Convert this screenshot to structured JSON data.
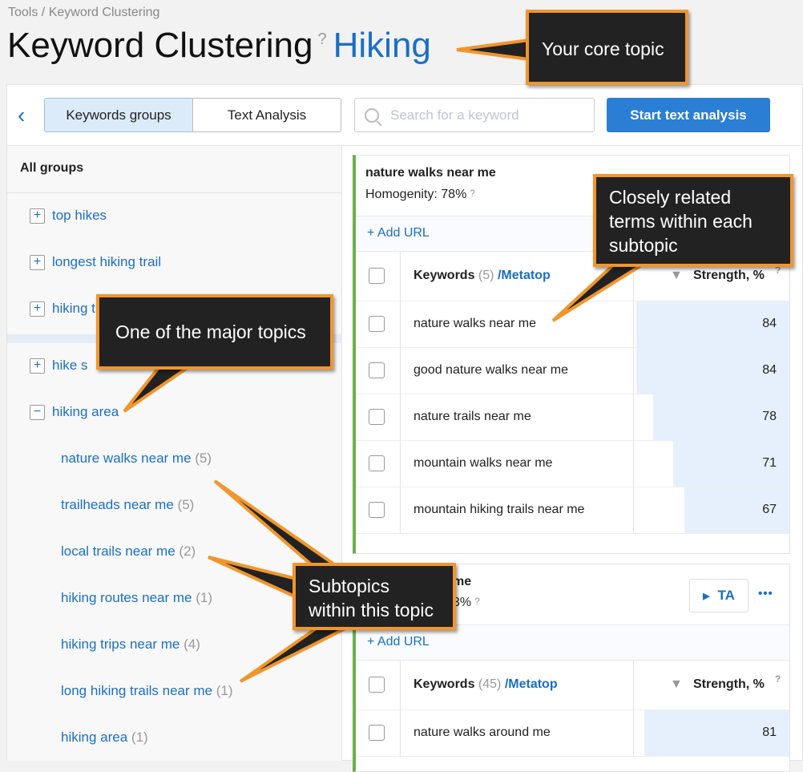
{
  "breadcrumb": "Tools / Keyword Clustering",
  "header": {
    "title": "Keyword Clustering",
    "help": "?",
    "topic": "Hiking"
  },
  "toolbar": {
    "back": "‹",
    "tabs": [
      "Keywords groups",
      "Text Analysis"
    ],
    "active_tab": "Keywords groups",
    "search_placeholder": "Search for a keyword",
    "start_button": "Start text analysis"
  },
  "sidebar": {
    "all_groups": "All groups",
    "groups": [
      {
        "label": "top hikes",
        "state": "collapsed"
      },
      {
        "label": "longest hiking trail",
        "state": "collapsed"
      },
      {
        "label": "hiking t",
        "state": "collapsed"
      },
      {
        "label": "hike s",
        "state": "collapsed"
      },
      {
        "label": "hiking area",
        "state": "expanded"
      }
    ],
    "subgroups": [
      {
        "label": "nature walks near me",
        "count": "(5)"
      },
      {
        "label": "trailheads near me",
        "count": "(5)"
      },
      {
        "label": "local trails near me",
        "count": "(2)"
      },
      {
        "label": "hiking routes near me",
        "count": "(1)"
      },
      {
        "label": "hiking trips near me",
        "count": "(4)"
      },
      {
        "label": "long hiking trails near me",
        "count": "(1)"
      },
      {
        "label": "hiking area",
        "count": "(1)"
      }
    ]
  },
  "cards": [
    {
      "title": "nature walks near me",
      "homogenity": "Homogenity: 78%",
      "add_url": "+ Add URL",
      "kw_label": "Keywords",
      "kw_count": "(5)",
      "metatop": "/Metatop",
      "strength_label": "Strength, %",
      "rows": [
        {
          "keyword": "nature walks near me",
          "strength": 84
        },
        {
          "keyword": "good nature walks near me",
          "strength": 84
        },
        {
          "keyword": "nature trails near me",
          "strength": 78
        },
        {
          "keyword": "mountain walks near me",
          "strength": 71
        },
        {
          "keyword": "mountain hiking trails near me",
          "strength": 67
        }
      ]
    },
    {
      "title": "me",
      "homogenity": "3%",
      "ta_button": "TA",
      "more": "•••",
      "add_url": "+ Add URL",
      "kw_label": "Keywords",
      "kw_count": "(45)",
      "metatop": "/Metatop",
      "strength_label": "Strength, %",
      "rows": [
        {
          "keyword": "nature walks around me",
          "strength": 81
        }
      ]
    }
  ],
  "callouts": [
    "Your core topic",
    "Closely related terms within each subtopic",
    "One of the major topics",
    "Subtopics within this topic"
  ],
  "colors": {
    "accent": "#1a6fc4",
    "callout_border": "#f0962e",
    "callout_bg": "#222222",
    "card_border": "#6ab04c"
  }
}
